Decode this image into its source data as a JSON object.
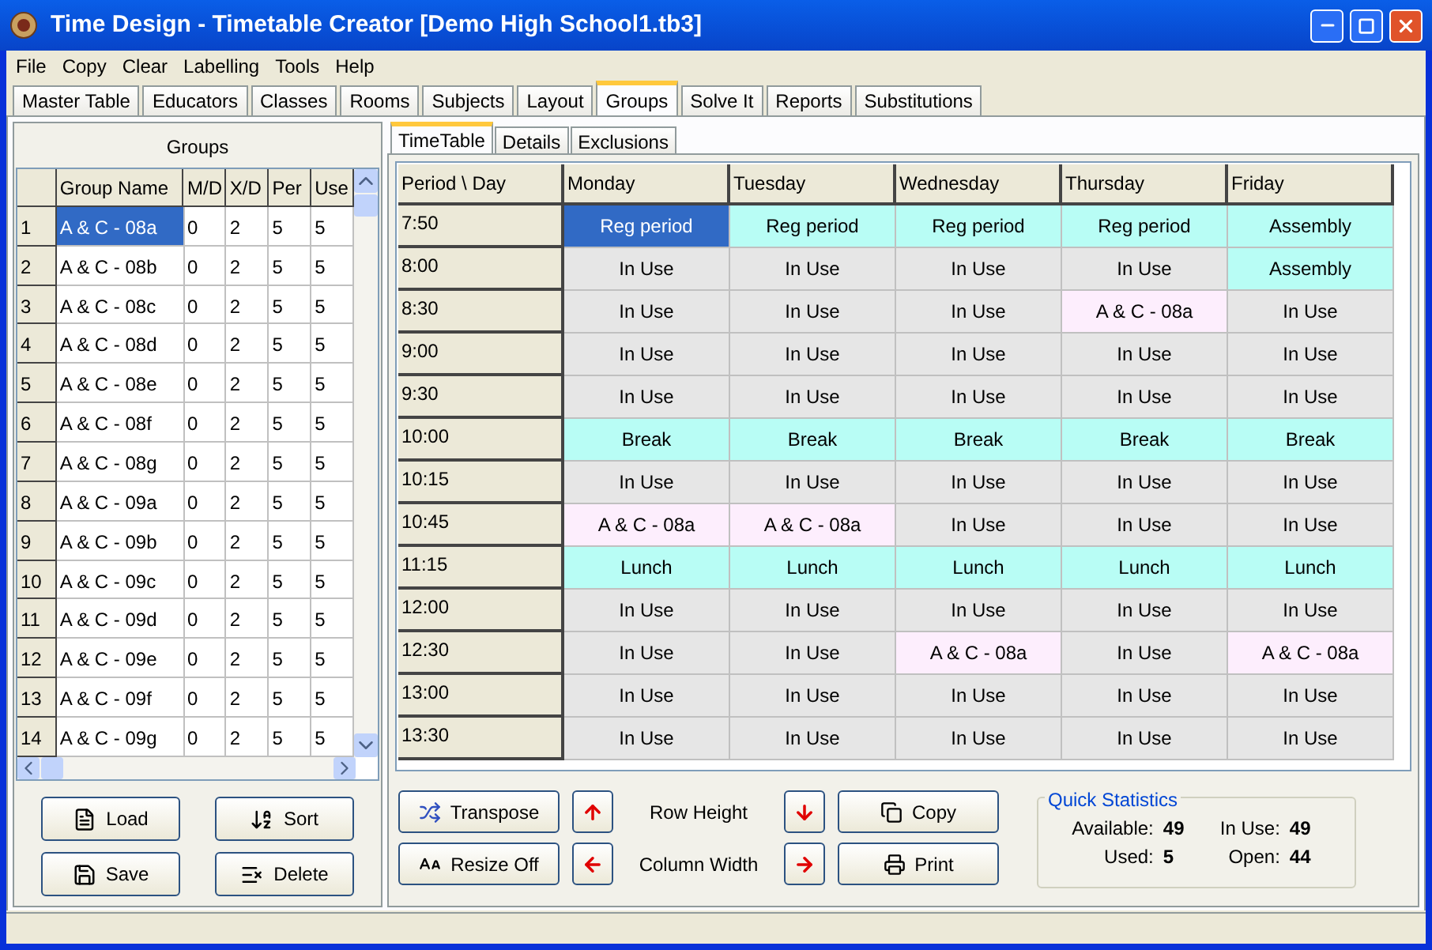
{
  "window": {
    "title": "Time Design - Timetable Creator [Demo High School1.tb3]"
  },
  "menu": [
    "File",
    "Copy",
    "Clear",
    "Labelling",
    "Tools",
    "Help"
  ],
  "tabs": [
    {
      "label": "Master Table",
      "selected": false
    },
    {
      "label": "Educators",
      "selected": false
    },
    {
      "label": "Classes",
      "selected": false
    },
    {
      "label": "Rooms",
      "selected": false
    },
    {
      "label": "Subjects",
      "selected": false
    },
    {
      "label": "Layout",
      "selected": false
    },
    {
      "label": "Groups",
      "selected": true
    },
    {
      "label": "Solve It",
      "selected": false
    },
    {
      "label": "Reports",
      "selected": false
    },
    {
      "label": "Substitutions",
      "selected": false
    }
  ],
  "groups_panel": {
    "title": "Groups",
    "columns": [
      "Group Name",
      "M/D",
      "X/D",
      "Per",
      "Use"
    ],
    "rows": [
      {
        "num": "1",
        "cells": [
          "A & C - 08a",
          "0",
          "2",
          "5",
          "5"
        ],
        "selected": true
      },
      {
        "num": "2",
        "cells": [
          "A & C - 08b",
          "0",
          "2",
          "5",
          "5"
        ],
        "selected": false
      },
      {
        "num": "3",
        "cells": [
          "A & C - 08c",
          "0",
          "2",
          "5",
          "5"
        ],
        "selected": false
      },
      {
        "num": "4",
        "cells": [
          "A & C - 08d",
          "0",
          "2",
          "5",
          "5"
        ],
        "selected": false
      },
      {
        "num": "5",
        "cells": [
          "A & C - 08e",
          "0",
          "2",
          "5",
          "5"
        ],
        "selected": false
      },
      {
        "num": "6",
        "cells": [
          "A & C - 08f",
          "0",
          "2",
          "5",
          "5"
        ],
        "selected": false
      },
      {
        "num": "7",
        "cells": [
          "A & C - 08g",
          "0",
          "2",
          "5",
          "5"
        ],
        "selected": false
      },
      {
        "num": "8",
        "cells": [
          "A & C - 09a",
          "0",
          "2",
          "5",
          "5"
        ],
        "selected": false
      },
      {
        "num": "9",
        "cells": [
          "A & C - 09b",
          "0",
          "2",
          "5",
          "5"
        ],
        "selected": false
      },
      {
        "num": "10",
        "cells": [
          "A & C - 09c",
          "0",
          "2",
          "5",
          "5"
        ],
        "selected": false
      },
      {
        "num": "11",
        "cells": [
          "A & C - 09d",
          "0",
          "2",
          "5",
          "5"
        ],
        "selected": false
      },
      {
        "num": "12",
        "cells": [
          "A & C - 09e",
          "0",
          "2",
          "5",
          "5"
        ],
        "selected": false
      },
      {
        "num": "13",
        "cells": [
          "A & C - 09f",
          "0",
          "2",
          "5",
          "5"
        ],
        "selected": false
      },
      {
        "num": "14",
        "cells": [
          "A & C - 09g",
          "0",
          "2",
          "5",
          "5"
        ],
        "selected": false
      }
    ],
    "buttons": [
      {
        "label": "Load",
        "kind": "load"
      },
      {
        "label": "Sort",
        "kind": "sort"
      },
      {
        "label": "Save",
        "kind": "save"
      },
      {
        "label": "Delete",
        "kind": "delete"
      }
    ]
  },
  "sub_tabs": [
    {
      "label": "TimeTable",
      "selected": true
    },
    {
      "label": "Details",
      "selected": false
    },
    {
      "label": "Exclusions",
      "selected": false
    }
  ],
  "timetable": {
    "corner": "Period \\ Day",
    "days": [
      "Monday",
      "Tuesday",
      "Wednesday",
      "Thursday",
      "Friday"
    ],
    "rows": [
      {
        "time": "7:50",
        "cells": [
          {
            "text": "Reg period",
            "kind": "fixed",
            "selected": true
          },
          {
            "text": "Reg period",
            "kind": "fixed",
            "selected": false
          },
          {
            "text": "Reg period",
            "kind": "fixed",
            "selected": false
          },
          {
            "text": "Reg period",
            "kind": "fixed",
            "selected": false
          },
          {
            "text": "Assembly",
            "kind": "fixed",
            "selected": false
          }
        ]
      },
      {
        "time": "8:00",
        "cells": [
          {
            "text": "In Use",
            "kind": "used",
            "selected": false
          },
          {
            "text": "In Use",
            "kind": "used",
            "selected": false
          },
          {
            "text": "In Use",
            "kind": "used",
            "selected": false
          },
          {
            "text": "In Use",
            "kind": "used",
            "selected": false
          },
          {
            "text": "Assembly",
            "kind": "fixed",
            "selected": false
          }
        ]
      },
      {
        "time": "8:30",
        "cells": [
          {
            "text": "In Use",
            "kind": "used",
            "selected": false
          },
          {
            "text": "In Use",
            "kind": "used",
            "selected": false
          },
          {
            "text": "In Use",
            "kind": "used",
            "selected": false
          },
          {
            "text": "A & C - 08a",
            "kind": "group",
            "selected": false
          },
          {
            "text": "In Use",
            "kind": "used",
            "selected": false
          }
        ]
      },
      {
        "time": "9:00",
        "cells": [
          {
            "text": "In Use",
            "kind": "used",
            "selected": false
          },
          {
            "text": "In Use",
            "kind": "used",
            "selected": false
          },
          {
            "text": "In Use",
            "kind": "used",
            "selected": false
          },
          {
            "text": "In Use",
            "kind": "used",
            "selected": false
          },
          {
            "text": "In Use",
            "kind": "used",
            "selected": false
          }
        ]
      },
      {
        "time": "9:30",
        "cells": [
          {
            "text": "In Use",
            "kind": "used",
            "selected": false
          },
          {
            "text": "In Use",
            "kind": "used",
            "selected": false
          },
          {
            "text": "In Use",
            "kind": "used",
            "selected": false
          },
          {
            "text": "In Use",
            "kind": "used",
            "selected": false
          },
          {
            "text": "In Use",
            "kind": "used",
            "selected": false
          }
        ]
      },
      {
        "time": "10:00",
        "cells": [
          {
            "text": "Break",
            "kind": "fixed",
            "selected": false
          },
          {
            "text": "Break",
            "kind": "fixed",
            "selected": false
          },
          {
            "text": "Break",
            "kind": "fixed",
            "selected": false
          },
          {
            "text": "Break",
            "kind": "fixed",
            "selected": false
          },
          {
            "text": "Break",
            "kind": "fixed",
            "selected": false
          }
        ]
      },
      {
        "time": "10:15",
        "cells": [
          {
            "text": "In Use",
            "kind": "used",
            "selected": false
          },
          {
            "text": "In Use",
            "kind": "used",
            "selected": false
          },
          {
            "text": "In Use",
            "kind": "used",
            "selected": false
          },
          {
            "text": "In Use",
            "kind": "used",
            "selected": false
          },
          {
            "text": "In Use",
            "kind": "used",
            "selected": false
          }
        ]
      },
      {
        "time": "10:45",
        "cells": [
          {
            "text": "A & C - 08a",
            "kind": "group",
            "selected": false
          },
          {
            "text": "A & C - 08a",
            "kind": "group",
            "selected": false
          },
          {
            "text": "In Use",
            "kind": "used",
            "selected": false
          },
          {
            "text": "In Use",
            "kind": "used",
            "selected": false
          },
          {
            "text": "In Use",
            "kind": "used",
            "selected": false
          }
        ]
      },
      {
        "time": "11:15",
        "cells": [
          {
            "text": "Lunch",
            "kind": "fixed",
            "selected": false
          },
          {
            "text": "Lunch",
            "kind": "fixed",
            "selected": false
          },
          {
            "text": "Lunch",
            "kind": "fixed",
            "selected": false
          },
          {
            "text": "Lunch",
            "kind": "fixed",
            "selected": false
          },
          {
            "text": "Lunch",
            "kind": "fixed",
            "selected": false
          }
        ]
      },
      {
        "time": "12:00",
        "cells": [
          {
            "text": "In Use",
            "kind": "used",
            "selected": false
          },
          {
            "text": "In Use",
            "kind": "used",
            "selected": false
          },
          {
            "text": "In Use",
            "kind": "used",
            "selected": false
          },
          {
            "text": "In Use",
            "kind": "used",
            "selected": false
          },
          {
            "text": "In Use",
            "kind": "used",
            "selected": false
          }
        ]
      },
      {
        "time": "12:30",
        "cells": [
          {
            "text": "In Use",
            "kind": "used",
            "selected": false
          },
          {
            "text": "In Use",
            "kind": "used",
            "selected": false
          },
          {
            "text": "A & C - 08a",
            "kind": "group",
            "selected": false
          },
          {
            "text": "In Use",
            "kind": "used",
            "selected": false
          },
          {
            "text": "A & C - 08a",
            "kind": "group",
            "selected": false
          }
        ]
      },
      {
        "time": "13:00",
        "cells": [
          {
            "text": "In Use",
            "kind": "used",
            "selected": false
          },
          {
            "text": "In Use",
            "kind": "used",
            "selected": false
          },
          {
            "text": "In Use",
            "kind": "used",
            "selected": false
          },
          {
            "text": "In Use",
            "kind": "used",
            "selected": false
          },
          {
            "text": "In Use",
            "kind": "used",
            "selected": false
          }
        ]
      },
      {
        "time": "13:30",
        "cells": [
          {
            "text": "In Use",
            "kind": "used",
            "selected": false
          },
          {
            "text": "In Use",
            "kind": "used",
            "selected": false
          },
          {
            "text": "In Use",
            "kind": "used",
            "selected": false
          },
          {
            "text": "In Use",
            "kind": "used",
            "selected": false
          },
          {
            "text": "In Use",
            "kind": "used",
            "selected": false
          }
        ]
      }
    ]
  },
  "controls": {
    "transpose": "Transpose",
    "resize": "Resize Off",
    "row_height": "Row Height",
    "column_width": "Column Width",
    "copy": "Copy",
    "print": "Print"
  },
  "quick_statistics": {
    "title": "Quick Statistics",
    "items": [
      {
        "label": "Available:",
        "value": "49"
      },
      {
        "label": "In Use:",
        "value": "49"
      },
      {
        "label": "Used:",
        "value": "5"
      },
      {
        "label": "Open:",
        "value": "44"
      }
    ]
  }
}
